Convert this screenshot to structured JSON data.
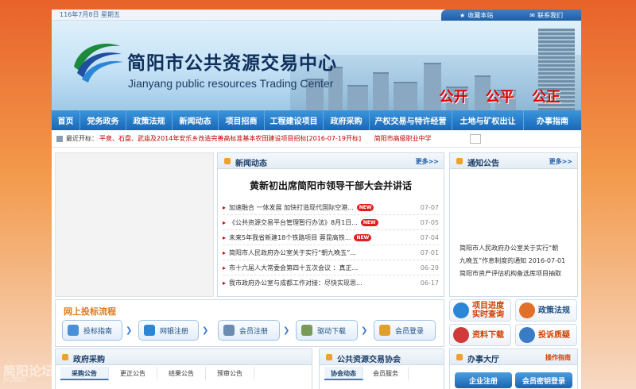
{
  "topbar": {
    "date": "116年7月8日 星期五",
    "favorite": "收藏本站",
    "contact": "联系我们"
  },
  "banner": {
    "title": "简阳市公共资源交易中心",
    "subtitle": "Jianyang public resources Trading Center",
    "slogan": "公开 公平 公正"
  },
  "nav": [
    "首页",
    "党务政务",
    "政策法规",
    "新闻动态",
    "项目招商",
    "工程建设项目",
    "政府采购",
    "产权交易与特许经营",
    "土地与矿权出让",
    "办事指南"
  ],
  "ticker": {
    "label": "最近开标：",
    "items": [
      "平泉、石盘、武庙及2014年安乐乡改造完善高标准基本农田建设项目招标[2016-07-19开标]",
      "简阳市高级职业中学"
    ]
  },
  "news": {
    "title": "新闻动态",
    "more": "更多>>",
    "headline": "黄新初出席简阳市领导干部大会并讲话",
    "items": [
      {
        "text": "加速融合 一体发展 加快打造现代国际空港...",
        "date": "07-07",
        "new": "NEW"
      },
      {
        "text": "《公共资源交易平台管理暂行办法》8月1日...",
        "date": "07-05",
        "new": "NEW"
      },
      {
        "text": "未来5年我省新建18个铁路项目 蓉昆高铁...",
        "date": "07-04",
        "new": "NEW"
      },
      {
        "text": "简阳市人民政府办公室关于实行“朝九晚五”...",
        "date": "07-01",
        "new": ""
      },
      {
        "text": "市十六届人大常委会第四十五次会议 ：真正...",
        "date": "06-29",
        "new": ""
      },
      {
        "text": "我市政府办公室与成都工作对接：尽快实现思...",
        "date": "06-17",
        "new": ""
      }
    ]
  },
  "notice": {
    "title": "通知公告",
    "more": "更多>>",
    "lines": [
      "简阳市人民政府办公室关于实行“朝",
      "九晚五”作息制度的通知 2016-07-01",
      "简阳市资产评估机构备选库项目抽取"
    ]
  },
  "flow": {
    "title": "网上投标流程",
    "steps": [
      "投标指南",
      "网银注册",
      "会员注册",
      "驱动下载",
      "会员登录"
    ]
  },
  "quick": [
    {
      "label": "项目进度\n实时查询",
      "color": "#2b86d6"
    },
    {
      "label": "政策法规",
      "color": "#e0702a"
    },
    {
      "label": "资料下载",
      "color": "#d03a3a"
    },
    {
      "label": "投诉质疑",
      "color": "#3a7cc4"
    }
  ],
  "procurement": {
    "title": "政府采购",
    "tabs": [
      "采购公告",
      "更正公告",
      "结果公告",
      "预审公告"
    ]
  },
  "resource": {
    "title": "公共资源交易协会",
    "tabs": [
      "协会动态",
      "会员服务"
    ]
  },
  "hall": {
    "title": "办事大厅",
    "link": "操作指南",
    "buttons": [
      "企业注册",
      "会员密钥登录"
    ]
  },
  "watermark": {
    "cn": "简阳论坛",
    "en": "JYOBBS"
  }
}
